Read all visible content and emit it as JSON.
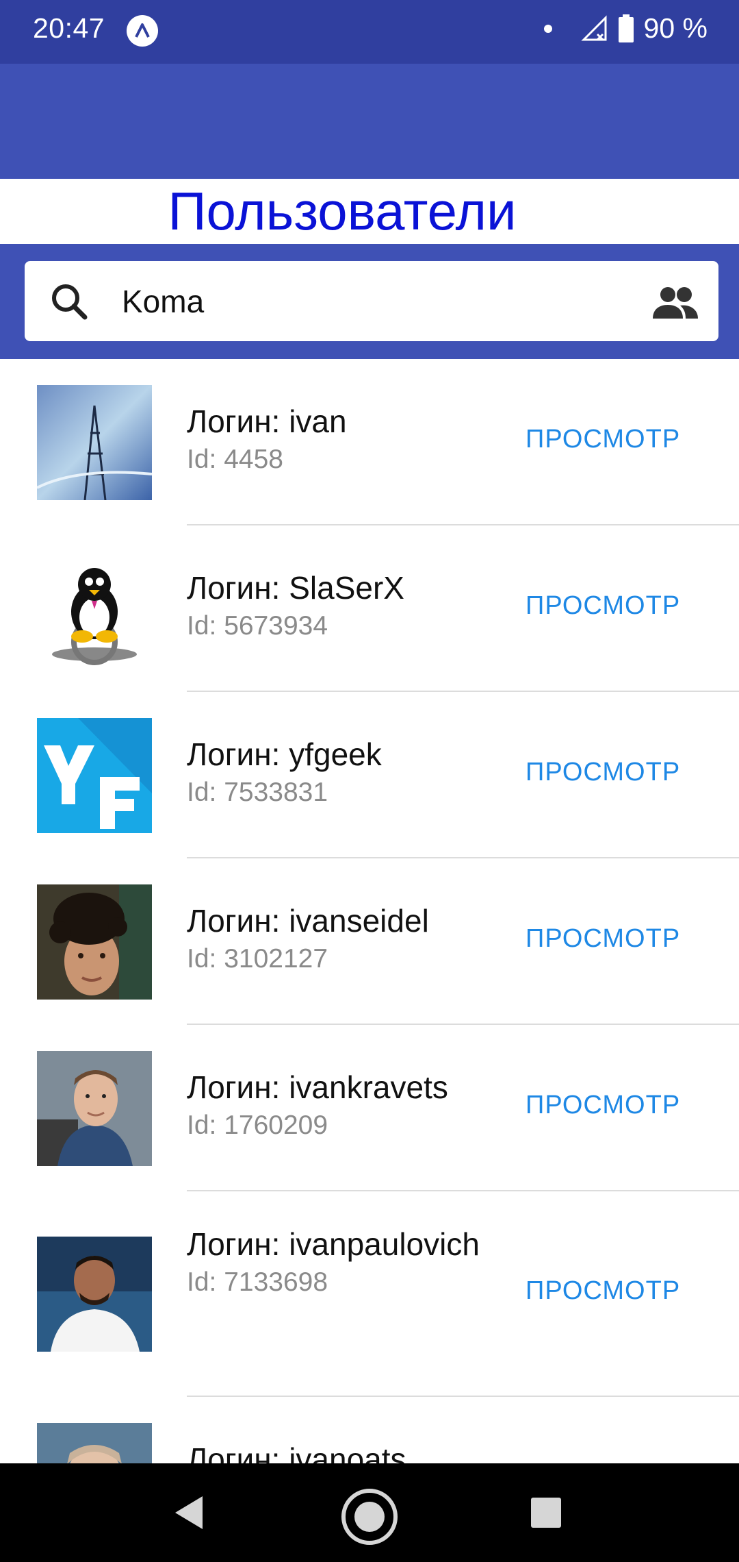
{
  "status_bar": {
    "time": "20:47",
    "battery_text": "90 %",
    "icons": [
      "app-notification-icon",
      "dot-icon",
      "signal-icon",
      "battery-icon"
    ]
  },
  "title": "Пользователи",
  "search": {
    "value": "Koma",
    "icons": [
      "search-icon",
      "users-icon"
    ]
  },
  "colors": {
    "status_bar": "#303f9f",
    "primary": "#3f51b5",
    "title": "#0a12d6",
    "action": "#1e88e5",
    "secondary_text": "#8a8a8a"
  },
  "users": [
    {
      "login": "Логин: ivan",
      "id": "Id: 4458",
      "action": "ПРОСМОТР",
      "avatar": "radio-tower-photo"
    },
    {
      "login": "Логин: SlaSerX",
      "id": "Id: 5673934",
      "action": "ПРОСМОТР",
      "avatar": "penguin-wheelchair"
    },
    {
      "login": "Логин: yfgeek",
      "id": "Id: 7533831",
      "action": "ПРОСМОТР",
      "avatar": "yf-logo"
    },
    {
      "login": "Логин: ivanseidel",
      "id": "Id: 3102127",
      "action": "ПРОСМОТР",
      "avatar": "portrait-curly-hair"
    },
    {
      "login": "Логин: ivankravets",
      "id": "Id: 1760209",
      "action": "ПРОСМОТР",
      "avatar": "portrait-hoodie"
    },
    {
      "login": "Логин: ivanpaulovich",
      "id": "Id: 7133698",
      "action": "ПРОСМОТР",
      "avatar": "portrait-sea"
    },
    {
      "login": "Логин: ivanoats",
      "id": "",
      "action": "",
      "avatar": "portrait-partial"
    }
  ],
  "nav": [
    "back-icon",
    "home-icon",
    "recent-apps-icon"
  ]
}
